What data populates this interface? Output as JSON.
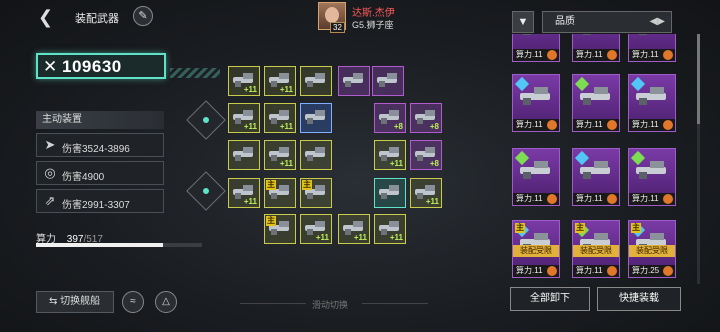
{
  "header": {
    "title": "装配武器",
    "player_name": "达斯.杰伊",
    "player_rank": "G5.狮子座",
    "player_level": "32"
  },
  "power": {
    "value": "109630"
  },
  "active_equipment": {
    "label": "主动装置",
    "skills": [
      {
        "icon": "damage-icon",
        "text": "伤害3524-3896"
      },
      {
        "icon": "target-icon",
        "text": "伤害4900"
      },
      {
        "icon": "missile-icon",
        "text": "伤害2991-3307"
      }
    ]
  },
  "energy": {
    "label": "算力",
    "used": "397",
    "max": "/517",
    "fraction": 0.768
  },
  "bottom": {
    "switch_ship": "切换舰船",
    "swipe_hint": "滑动切换"
  },
  "slots": [
    {
      "plus": "+11"
    },
    {
      "plus": "+11"
    },
    {
      "plus": ""
    },
    {
      "plus": ""
    },
    {
      "plus": ""
    },
    {
      "plus": "+11"
    },
    {
      "plus": "+11"
    },
    {
      "plus": ""
    },
    {
      "plus": "+8"
    },
    {
      "plus": "+8"
    },
    {
      "plus": ""
    },
    {
      "plus": "+11"
    },
    {
      "plus": ""
    },
    {
      "plus": "+11"
    },
    {
      "plus": "+8"
    },
    {
      "plus": "+11"
    },
    {
      "plus": "主"
    },
    {
      "plus": "主"
    },
    {
      "plus": ""
    },
    {
      "plus": "+11"
    },
    {
      "plus": "主"
    },
    {
      "plus": "+11"
    },
    {
      "plus": "+11"
    },
    {
      "plus": "+11"
    }
  ],
  "right_panel": {
    "quality_label": "品质",
    "cards": [
      {
        "cost": "算力.11",
        "badge": ""
      },
      {
        "cost": "算力.11",
        "badge": ""
      },
      {
        "cost": "算力.11",
        "badge": ""
      },
      {
        "cost": "算力.11",
        "badge": ""
      },
      {
        "cost": "算力.11",
        "badge": ""
      },
      {
        "cost": "算力.11",
        "badge": ""
      },
      {
        "cost": "算力.11",
        "badge": ""
      },
      {
        "cost": "算力.11",
        "badge": ""
      },
      {
        "cost": "算力.11",
        "badge": ""
      },
      {
        "cost": "算力.11",
        "badge": "装配受限"
      },
      {
        "cost": "算力.11",
        "badge": "装配受限"
      },
      {
        "cost": "算力.25",
        "badge": "装配受限"
      }
    ],
    "unload_all": "全部卸下",
    "quick_equip": "快捷装载"
  },
  "colors": {
    "accent": "#5fe3c8",
    "slot_yellow": "#c8cc4a",
    "slot_purple": "#b35ad0",
    "card_purple": "#7a3aa6"
  }
}
